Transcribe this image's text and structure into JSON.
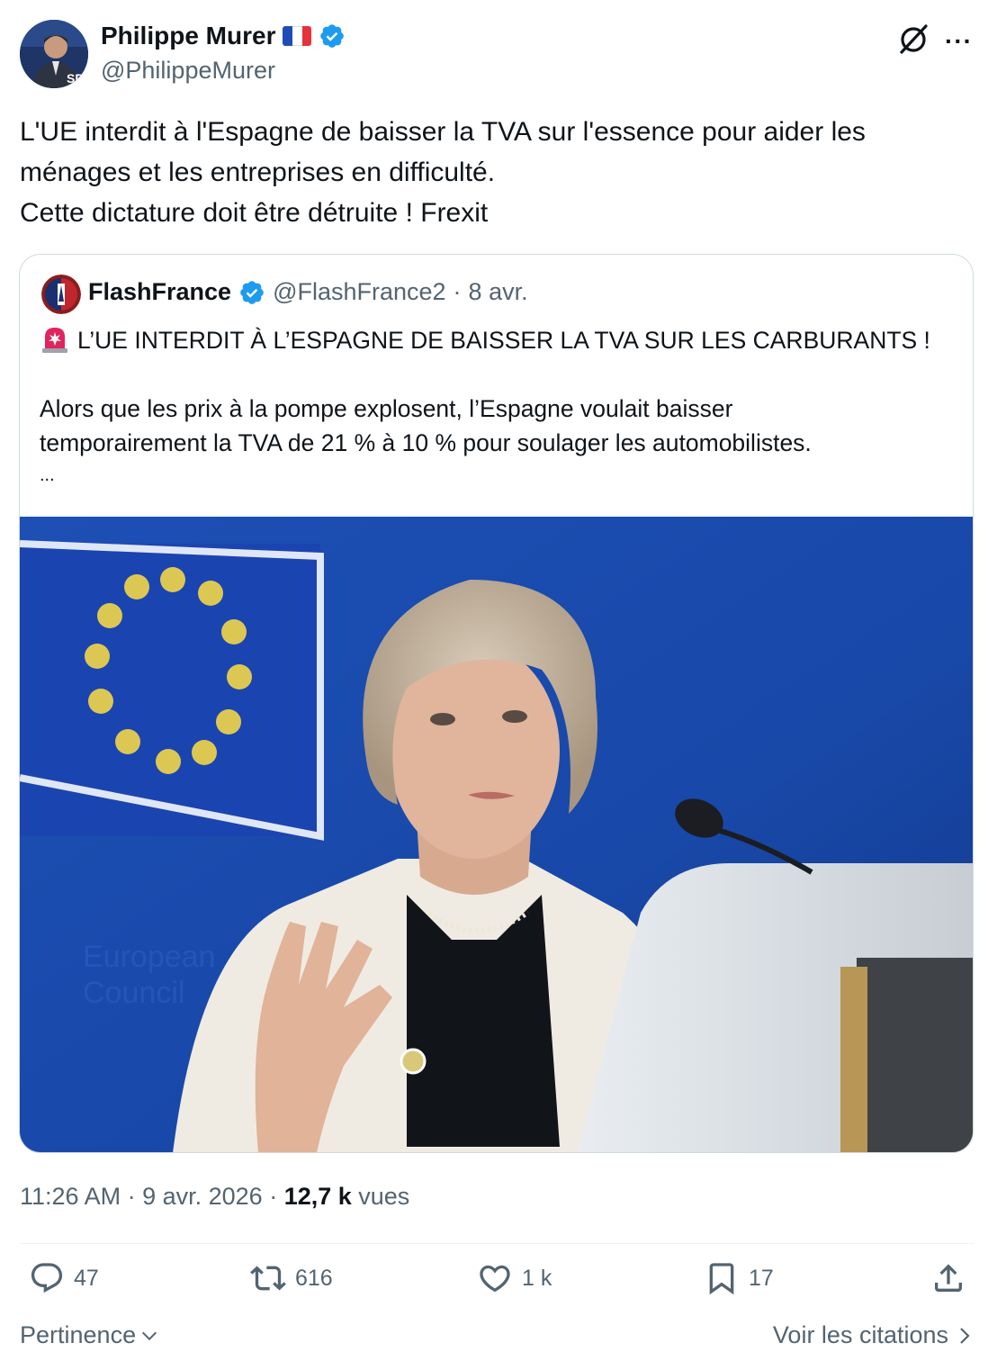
{
  "author": {
    "name": "Philippe Murer",
    "handle": "@PhilippeMurer"
  },
  "tweet": {
    "lines": [
      "L'UE interdit à l'Espagne de baisser la TVA sur l'essence pour aider les",
      "ménages et les entreprises en difficulté.",
      "Cette dictature doit être détruite ! Frexit"
    ]
  },
  "quote": {
    "name": "FlashFrance",
    "handle": "@FlashFrance2",
    "separator": "·",
    "date": "8 avr.",
    "headline": "L’UE INTERDIT À L’ESPAGNE DE BAISSER LA TVA SUR LES CARBURANTS !",
    "body_lines": [
      "Alors que les prix à la pompe explosent, l’Espagne voulait baisser",
      "temporairement la TVA de 21 % à 10 % pour soulager les automobilistes."
    ],
    "ellipsis": "..."
  },
  "meta": {
    "time": "11:26 AM",
    "sep1": " · ",
    "date": "9 avr. 2026",
    "sep2": " · ",
    "views_count": "12,7 k",
    "views_label": " vues"
  },
  "actions": {
    "replies": "47",
    "reposts": "616",
    "likes": "1 k",
    "bookmarks": "17"
  },
  "footer": {
    "sort_label": "Pertinence",
    "quotes_link": "Voir les citations"
  },
  "colors": {
    "verified": "#1d9bf0",
    "secondary_text": "#536471",
    "primary_text": "#0f1419",
    "border": "#cfd9de"
  }
}
